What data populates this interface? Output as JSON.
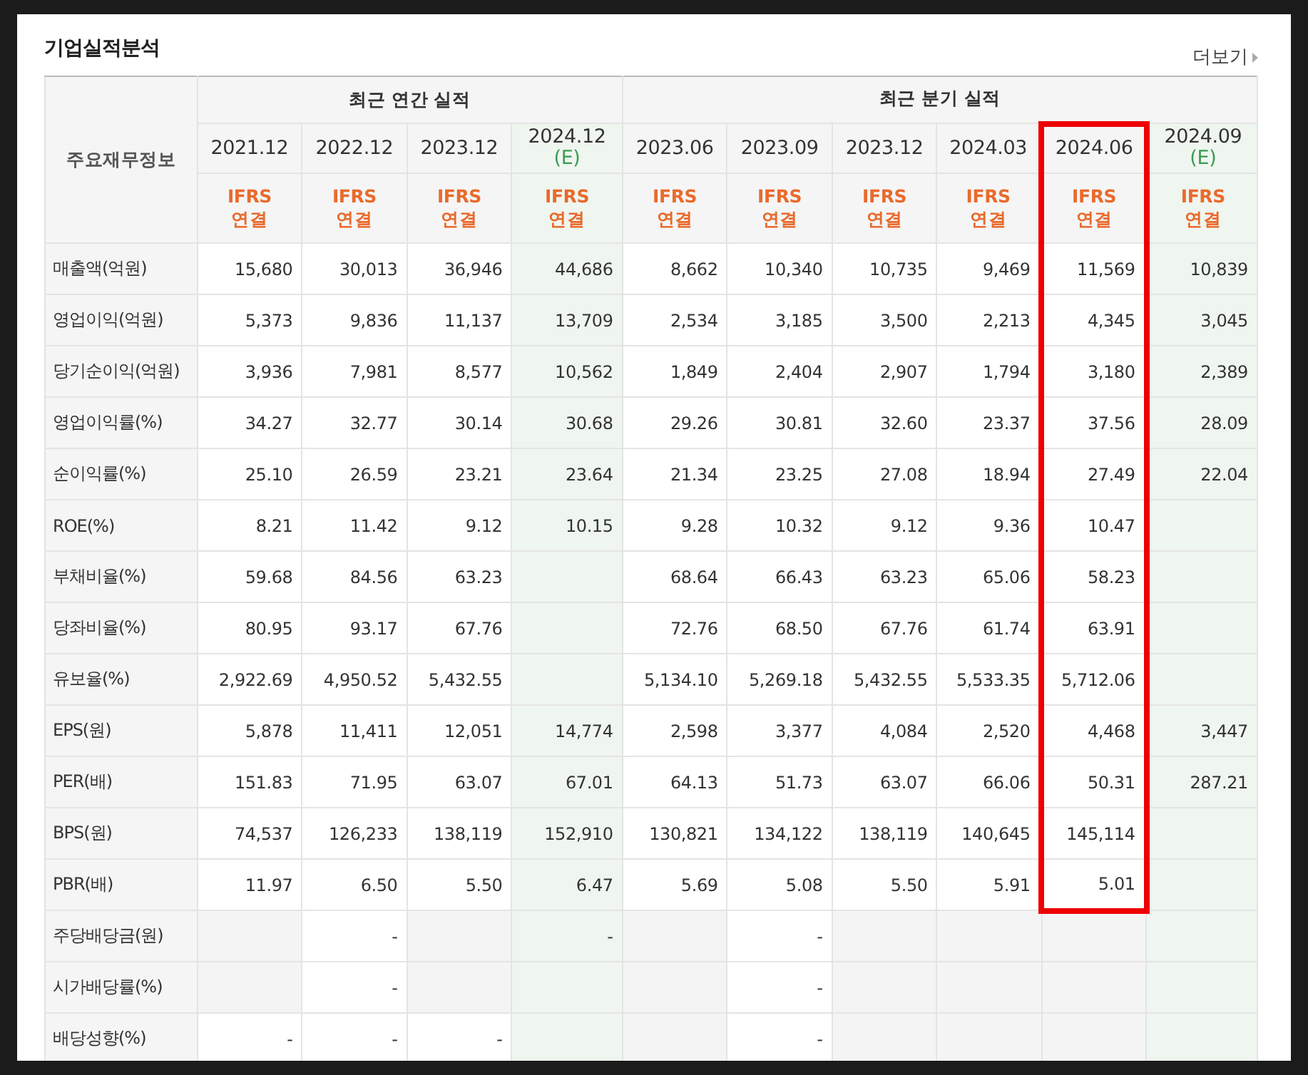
{
  "title": "기업실적분석",
  "more_link": "더보기",
  "corner_label": "주요재무정보",
  "column_groups": [
    {
      "title": "최근 연간 실적",
      "columns": [
        {
          "date": "2021.12",
          "basis": "IFRS",
          "consolidation": "연결",
          "estimate": false,
          "highlighted": false
        },
        {
          "date": "2022.12",
          "basis": "IFRS",
          "consolidation": "연결",
          "estimate": false,
          "highlighted": false
        },
        {
          "date": "2023.12",
          "basis": "IFRS",
          "consolidation": "연결",
          "estimate": false,
          "highlighted": false
        },
        {
          "date": "2024.12",
          "note": "(E)",
          "basis": "IFRS",
          "consolidation": "연결",
          "estimate": true,
          "highlighted": false
        }
      ]
    },
    {
      "title": "최근 분기 실적",
      "columns": [
        {
          "date": "2023.06",
          "basis": "IFRS",
          "consolidation": "연결",
          "estimate": false,
          "highlighted": false
        },
        {
          "date": "2023.09",
          "basis": "IFRS",
          "consolidation": "연결",
          "estimate": false,
          "highlighted": false
        },
        {
          "date": "2023.12",
          "basis": "IFRS",
          "consolidation": "연결",
          "estimate": false,
          "highlighted": false
        },
        {
          "date": "2024.03",
          "basis": "IFRS",
          "consolidation": "연결",
          "estimate": false,
          "highlighted": false
        },
        {
          "date": "2024.06",
          "basis": "IFRS",
          "consolidation": "연결",
          "estimate": false,
          "highlighted": true
        },
        {
          "date": "2024.09",
          "note": "(E)",
          "basis": "IFRS",
          "consolidation": "연결",
          "estimate": true,
          "highlighted": false
        }
      ]
    }
  ],
  "sections": [
    {
      "highlighted": true,
      "rows": [
        {
          "label": "매출액(억원)",
          "cells": [
            "15,680",
            "30,013",
            "36,946",
            "44,686",
            "8,662",
            "10,340",
            "10,735",
            "9,469",
            "11,569",
            "10,839"
          ]
        },
        {
          "label": "영업이익(억원)",
          "cells": [
            "5,373",
            "9,836",
            "11,137",
            "13,709",
            "2,534",
            "3,185",
            "3,500",
            "2,213",
            "4,345",
            "3,045"
          ]
        },
        {
          "label": "당기순이익(억원)",
          "cells": [
            "3,936",
            "7,981",
            "8,577",
            "10,562",
            "1,849",
            "2,404",
            "2,907",
            "1,794",
            "3,180",
            "2,389"
          ]
        }
      ]
    },
    {
      "highlighted": true,
      "rows": [
        {
          "label": "영업이익률(%)",
          "cells": [
            "34.27",
            "32.77",
            "30.14",
            "30.68",
            "29.26",
            "30.81",
            "32.60",
            "23.37",
            "37.56",
            "28.09"
          ]
        },
        {
          "label": "순이익률(%)",
          "cells": [
            "25.10",
            "26.59",
            "23.21",
            "23.64",
            "21.34",
            "23.25",
            "27.08",
            "18.94",
            "27.49",
            "22.04"
          ]
        },
        {
          "label": "ROE(%)",
          "cells": [
            "8.21",
            "11.42",
            "9.12",
            "10.15",
            "9.28",
            "10.32",
            "9.12",
            "9.36",
            "10.47",
            null
          ]
        }
      ]
    },
    {
      "highlighted": true,
      "rows": [
        {
          "label": "부채비율(%)",
          "cells": [
            "59.68",
            "84.56",
            "63.23",
            null,
            "68.64",
            "66.43",
            "63.23",
            "65.06",
            "58.23",
            null
          ]
        },
        {
          "label": "당좌비율(%)",
          "cells": [
            "80.95",
            "93.17",
            "67.76",
            null,
            "72.76",
            "68.50",
            "67.76",
            "61.74",
            "63.91",
            null
          ]
        },
        {
          "label": "유보율(%)",
          "cells": [
            "2,922.69",
            "4,950.52",
            "5,432.55",
            null,
            "5,134.10",
            "5,269.18",
            "5,432.55",
            "5,533.35",
            "5,712.06",
            null
          ]
        }
      ]
    },
    {
      "highlighted": true,
      "rows": [
        {
          "label": "EPS(원)",
          "cells": [
            "5,878",
            "11,411",
            "12,051",
            "14,774",
            "2,598",
            "3,377",
            "4,084",
            "2,520",
            "4,468",
            "3,447"
          ]
        },
        {
          "label": "PER(배)",
          "cells": [
            "151.83",
            "71.95",
            "63.07",
            "67.01",
            "64.13",
            "51.73",
            "63.07",
            "66.06",
            "50.31",
            "287.21"
          ]
        },
        {
          "label": "BPS(원)",
          "cells": [
            "74,537",
            "126,233",
            "138,119",
            "152,910",
            "130,821",
            "134,122",
            "138,119",
            "140,645",
            "145,114",
            null
          ]
        },
        {
          "label": "PBR(배)",
          "cells": [
            "11.97",
            "6.50",
            "5.50",
            "6.47",
            "5.69",
            "5.08",
            "5.50",
            "5.91",
            "5.01",
            null
          ]
        }
      ]
    },
    {
      "highlighted": false,
      "rows": [
        {
          "label": "주당배당금(원)",
          "cells": [
            null,
            "-",
            null,
            "-",
            null,
            "-",
            null,
            null,
            null,
            null
          ]
        },
        {
          "label": "시가배당률(%)",
          "cells": [
            null,
            "-",
            null,
            null,
            null,
            "-",
            null,
            null,
            null,
            null
          ]
        },
        {
          "label": "배당성향(%)",
          "cells": [
            "-",
            "-",
            "-",
            null,
            null,
            "-",
            null,
            null,
            null,
            null
          ]
        }
      ]
    }
  ]
}
